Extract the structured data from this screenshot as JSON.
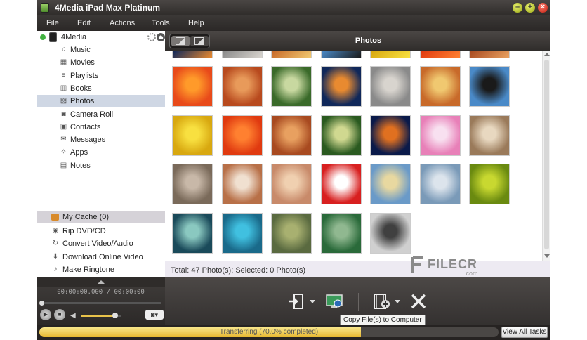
{
  "window": {
    "title": "4Media iPad Max Platinum"
  },
  "menu": [
    "File",
    "Edit",
    "Actions",
    "Tools",
    "Help"
  ],
  "device": {
    "name": "4Media"
  },
  "sidebar": {
    "items": [
      {
        "label": "Music",
        "icon": "music-note-icon",
        "glyph": "♫"
      },
      {
        "label": "Movies",
        "icon": "film-icon",
        "glyph": "▦"
      },
      {
        "label": "Playlists",
        "icon": "playlist-icon",
        "glyph": "≡"
      },
      {
        "label": "Books",
        "icon": "book-icon",
        "glyph": "▥"
      },
      {
        "label": "Photos",
        "icon": "photo-icon",
        "glyph": "▨",
        "active": true
      },
      {
        "label": "Camera Roll",
        "icon": "camera-icon",
        "glyph": "◙"
      },
      {
        "label": "Contacts",
        "icon": "contacts-icon",
        "glyph": "▣"
      },
      {
        "label": "Messages",
        "icon": "messages-icon",
        "glyph": "✉"
      },
      {
        "label": "Apps",
        "icon": "apps-icon",
        "glyph": "✧"
      },
      {
        "label": "Notes",
        "icon": "notes-icon",
        "glyph": "▤"
      }
    ],
    "cache": "My Cache (0)",
    "tools": [
      {
        "label": "Rip DVD/CD",
        "icon": "disc-icon",
        "glyph": "◉"
      },
      {
        "label": "Convert Video/Audio",
        "icon": "convert-icon",
        "glyph": "↻"
      },
      {
        "label": "Download Online Video",
        "icon": "download-icon",
        "glyph": "⬇"
      },
      {
        "label": "Make Ringtone",
        "icon": "bell-icon",
        "glyph": "♪"
      }
    ]
  },
  "player": {
    "time": "00:00:00.000 / 00:00:00",
    "volume_level": 0.85,
    "seek_level": 0.0
  },
  "main": {
    "title": "Photos",
    "status": "Total: 47 Photo(s); Selected: 0 Photo(s)",
    "thumbnails": [
      [
        "#e84a1a",
        "#ff9a2a"
      ],
      [
        "#b84a1e",
        "#e89a5a"
      ],
      [
        "#3a6a2a",
        "#c8d8a0"
      ],
      [
        "#10285a",
        "#e88a30"
      ],
      [
        "#8a8a8a",
        "#d8d4ce"
      ],
      [
        "#c86a2a",
        "#f0c870"
      ],
      [
        "#4a8ac8",
        "#1a1a1a"
      ],
      [
        "#d8a810",
        "#f8e040"
      ],
      [
        "#e03a10",
        "#ff8030"
      ],
      [
        "#a84a20",
        "#e8a060"
      ],
      [
        "#2a5a20",
        "#d0d890"
      ],
      [
        "#0a1a4a",
        "#e07020"
      ],
      [
        "#e880b8",
        "#f8e0f0"
      ],
      [
        "#9a7a5a",
        "#e8d8c0"
      ],
      [
        "#7a6a5a",
        "#c8b8a8"
      ],
      [
        "#b87048",
        "#f0e0d0"
      ],
      [
        "#c88a6a",
        "#f0d0b0"
      ],
      [
        "#d82020",
        "#ffffff"
      ],
      [
        "#6a9ac8",
        "#e8d8a0"
      ],
      [
        "#7a9ab8",
        "#dce4ec"
      ],
      [
        "#6a8a10",
        "#c8d830"
      ],
      [
        "#1a4a5a",
        "#8ac8c0"
      ],
      [
        "#1a6a8a",
        "#40c0e0"
      ],
      [
        "#5a6a40",
        "#a8b070"
      ],
      [
        "#2a6a3a",
        "#90b890"
      ],
      [
        "#d0d0d0",
        "#404040"
      ]
    ]
  },
  "toolbar": {
    "tooltip": "Copy File(s) to Computer"
  },
  "transfer": {
    "label": "Transferring (70.0% completed)",
    "progress": 0.7,
    "button": "View All Tasks"
  },
  "watermark": {
    "text": "FILECR",
    "sub": ".com"
  }
}
